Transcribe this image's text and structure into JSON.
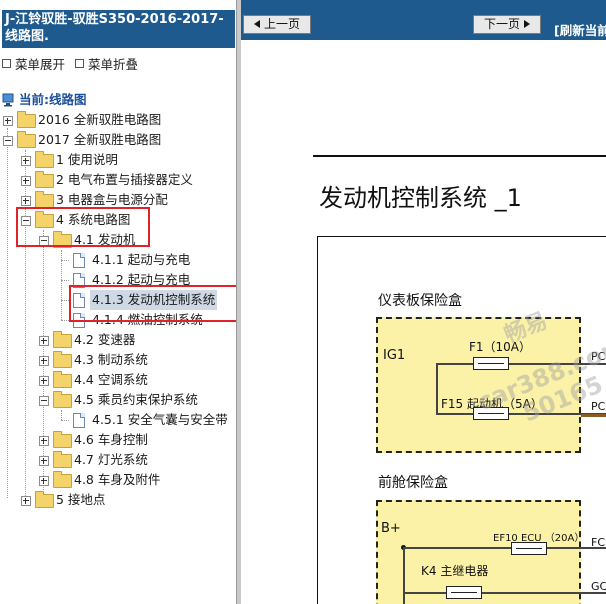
{
  "app_title": "J-江铃驭胜-驭胜S350-2016-2017- 线路图.",
  "menu": {
    "expand_label": "菜单展开",
    "collapse_label": "菜单折叠"
  },
  "tree": {
    "current_label": "当前:线路图",
    "items": [
      {
        "label": "2016 全新驭胜电路图"
      },
      {
        "label": "2017 全新驭胜电路图"
      },
      {
        "label": "1 使用说明"
      },
      {
        "label": "2 电气布置与插接器定义"
      },
      {
        "label": "3 电器盒与电源分配"
      },
      {
        "label": "4 系统电路图"
      },
      {
        "label": "4.1 发动机"
      },
      {
        "label": "4.1.1 起动与充电"
      },
      {
        "label": "4.1.2 起动与充电"
      },
      {
        "label": "4.1.3 发动机控制系统"
      },
      {
        "label": "4.1.4 燃油控制系统"
      },
      {
        "label": "4.2 变速器"
      },
      {
        "label": "4.3 制动系统"
      },
      {
        "label": "4.4 空调系统"
      },
      {
        "label": "4.5 乘员约束保护系统"
      },
      {
        "label": "4.5.1 安全气囊与安全带"
      },
      {
        "label": "4.6 车身控制"
      },
      {
        "label": "4.7 灯光系统"
      },
      {
        "label": "4.8 车身及附件"
      },
      {
        "label": "5 接地点"
      }
    ]
  },
  "nav": {
    "prev_label": "上一页",
    "next_label": "下一页",
    "refresh_label": "[刷新当前"
  },
  "document": {
    "title": "发动机控制系统 _1",
    "box1": {
      "title": "仪表板保险盒",
      "ig1": "IG1",
      "f1": "F1（10A）",
      "f15": "F15 起动机（5A）",
      "wire1": "PC",
      "wire2": "PC"
    },
    "box2": {
      "title": "前舱保险盒",
      "bplus": "B+",
      "ef10": "EF10 ECU （20A）",
      "k4": "K4 主继电器",
      "wire1": "FC",
      "wire2": "GC"
    }
  },
  "watermark": {
    "line1": "畅易",
    "line2": "car388.com",
    "line3": "50165"
  },
  "colors": {
    "header_blue": "#1e5a8e",
    "fuse_box_fill": "#fbf2a8",
    "highlight_red": "#e0222a",
    "selection": "#cfd9e6"
  }
}
